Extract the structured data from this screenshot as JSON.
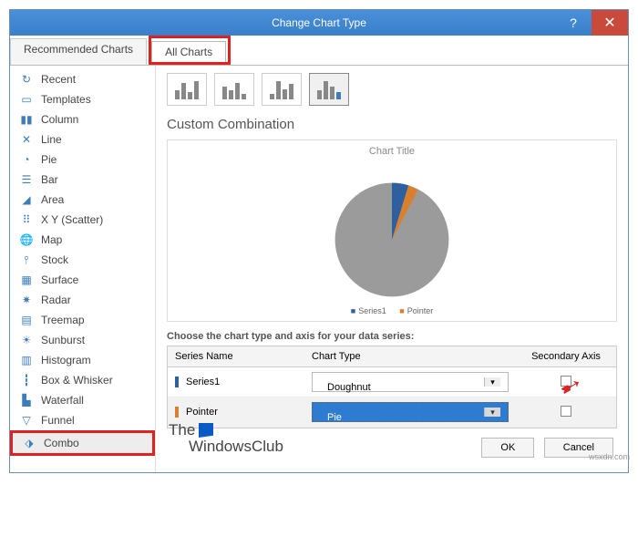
{
  "title": "Change Chart Type",
  "tabs": {
    "rec": "Recommended Charts",
    "all": "All Charts"
  },
  "sidebar": [
    {
      "k": "recent",
      "l": "Recent"
    },
    {
      "k": "templates",
      "l": "Templates"
    },
    {
      "k": "column",
      "l": "Column"
    },
    {
      "k": "line",
      "l": "Line"
    },
    {
      "k": "pie",
      "l": "Pie"
    },
    {
      "k": "bar",
      "l": "Bar"
    },
    {
      "k": "area",
      "l": "Area"
    },
    {
      "k": "xy",
      "l": "X Y (Scatter)"
    },
    {
      "k": "map",
      "l": "Map"
    },
    {
      "k": "stock",
      "l": "Stock"
    },
    {
      "k": "surface",
      "l": "Surface"
    },
    {
      "k": "radar",
      "l": "Radar"
    },
    {
      "k": "treemap",
      "l": "Treemap"
    },
    {
      "k": "sunburst",
      "l": "Sunburst"
    },
    {
      "k": "histogram",
      "l": "Histogram"
    },
    {
      "k": "boxwhisker",
      "l": "Box & Whisker"
    },
    {
      "k": "waterfall",
      "l": "Waterfall"
    },
    {
      "k": "funnel",
      "l": "Funnel"
    },
    {
      "k": "combo",
      "l": "Combo"
    }
  ],
  "sidebar_selected": "combo",
  "heading": "Custom Combination",
  "preview": {
    "title": "Chart Title",
    "legend1": "Series1",
    "legend2": "Pointer"
  },
  "choose_label": "Choose the chart type and axis for your data series:",
  "grid": {
    "col_series": "Series Name",
    "col_type": "Chart Type",
    "col_axis": "Secondary Axis",
    "rows": [
      {
        "name": "Series1",
        "type": "Doughnut",
        "open": false,
        "axis": false
      },
      {
        "name": "Pointer",
        "type": "Pie",
        "open": true,
        "axis": false
      }
    ]
  },
  "buttons": {
    "ok": "OK",
    "cancel": "Cancel"
  },
  "watermark": {
    "l1": "The",
    "l2": "WindowsClub"
  },
  "url": "wsxdn.com",
  "chart_data": {
    "type": "pie",
    "title": "Chart Title",
    "series": [
      {
        "name": "Series1",
        "values": [
          92
        ],
        "color": "#9b9b9b"
      },
      {
        "name": "Pointer",
        "values": [
          5,
          3
        ],
        "color": "#2e5f9e"
      }
    ]
  }
}
